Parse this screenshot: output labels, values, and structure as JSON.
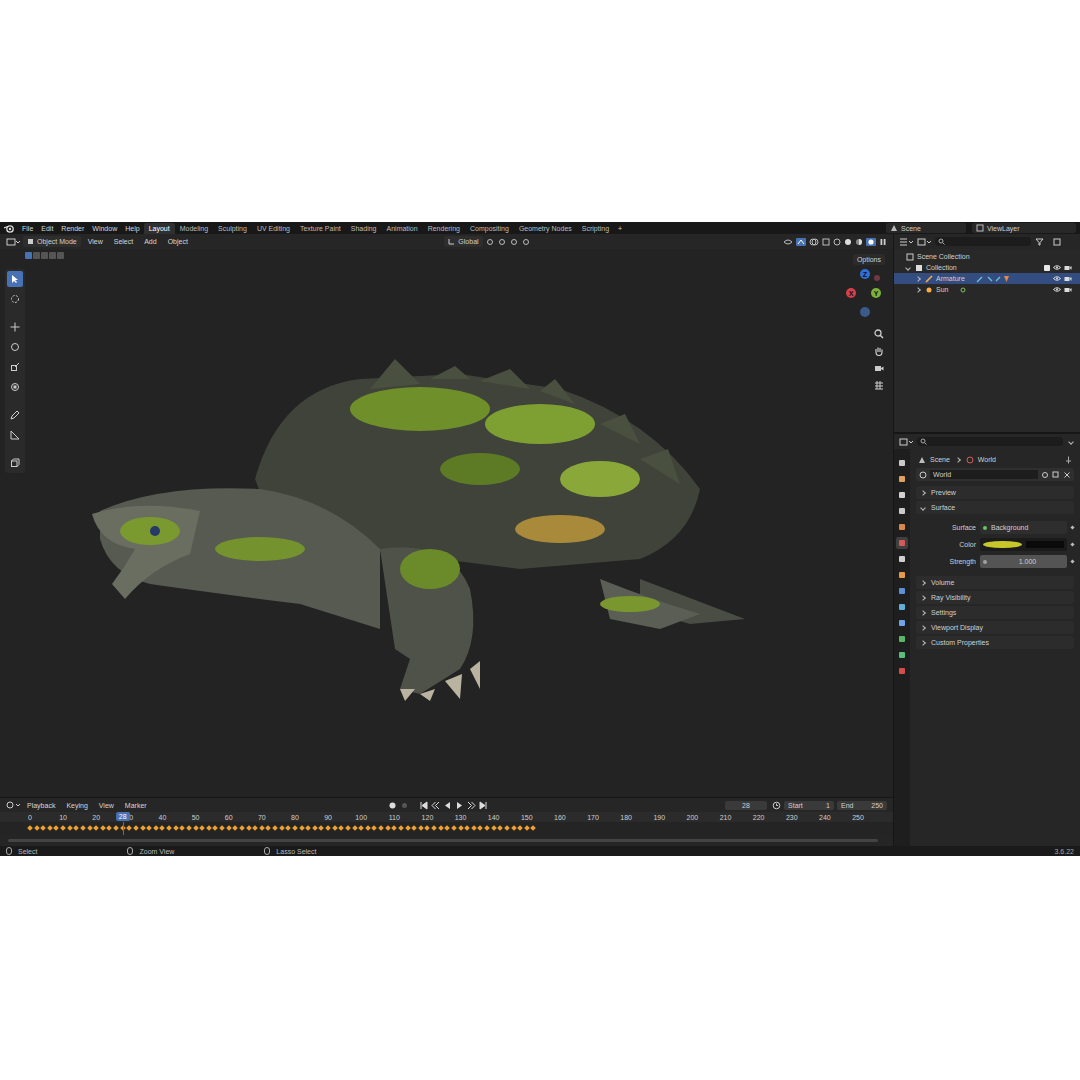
{
  "menu": [
    "File",
    "Edit",
    "Render",
    "Window",
    "Help"
  ],
  "workspaces": [
    {
      "label": "Layout",
      "selected": true
    },
    {
      "label": "Modeling",
      "selected": false
    },
    {
      "label": "Sculpting",
      "selected": false
    },
    {
      "label": "UV Editing",
      "selected": false
    },
    {
      "label": "Texture Paint",
      "selected": false
    },
    {
      "label": "Shading",
      "selected": false
    },
    {
      "label": "Animation",
      "selected": false
    },
    {
      "label": "Rendering",
      "selected": false
    },
    {
      "label": "Compositing",
      "selected": false
    },
    {
      "label": "Geometry Nodes",
      "selected": false
    },
    {
      "label": "Scripting",
      "selected": false
    }
  ],
  "workspace_add": "+",
  "scene": "Scene",
  "view_layer": "ViewLayer",
  "header": {
    "mode": "Object Mode",
    "menus": [
      "View",
      "Select",
      "Add",
      "Object"
    ],
    "orientation": "Global",
    "options": "Options"
  },
  "gizmo": [
    {
      "label": "Z",
      "color": "#2f6fd6"
    },
    {
      "label": "X",
      "color": "#d6404a"
    },
    {
      "label": "Y",
      "color": "#7db13a"
    }
  ],
  "outliner": {
    "root": "Scene Collection",
    "collection": "Collection",
    "items": [
      {
        "label": "Armature",
        "selected": true
      },
      {
        "label": "Sun",
        "selected": false
      }
    ]
  },
  "properties": {
    "breadcrumb": [
      "Scene",
      "World"
    ],
    "world_name": "World",
    "sections_before": [
      {
        "label": "Preview",
        "expanded": false
      },
      {
        "label": "Surface",
        "expanded": true
      }
    ],
    "fields": [
      {
        "label": "Surface",
        "value": "Background",
        "kind": "shader"
      },
      {
        "label": "Color",
        "value": "",
        "kind": "swatch"
      },
      {
        "label": "Strength",
        "value": "1.000",
        "kind": "number"
      }
    ],
    "sections_after": [
      {
        "label": "Volume",
        "expanded": false
      },
      {
        "label": "Ray Visibility",
        "expanded": false
      },
      {
        "label": "Settings",
        "expanded": false
      },
      {
        "label": "Viewport Display",
        "expanded": false
      },
      {
        "label": "Custom Properties",
        "expanded": false
      }
    ]
  },
  "timeline": {
    "menus": [
      "Playback",
      "Keying",
      "View",
      "Marker"
    ],
    "current_frame": "28",
    "start_label": "Start",
    "start": "1",
    "end_label": "End",
    "end": "250",
    "ticks": [
      "0",
      "10",
      "20",
      "30",
      "40",
      "50",
      "60",
      "70",
      "80",
      "90",
      "100",
      "110",
      "120",
      "130",
      "140",
      "150",
      "160",
      "170",
      "180",
      "190",
      "200",
      "210",
      "220",
      "230",
      "240",
      "250"
    ],
    "keyframe_range": [
      0,
      152
    ]
  },
  "status": {
    "items": [
      "Select",
      "Zoom View",
      "Lasso Select"
    ],
    "version": "3.6.22"
  }
}
